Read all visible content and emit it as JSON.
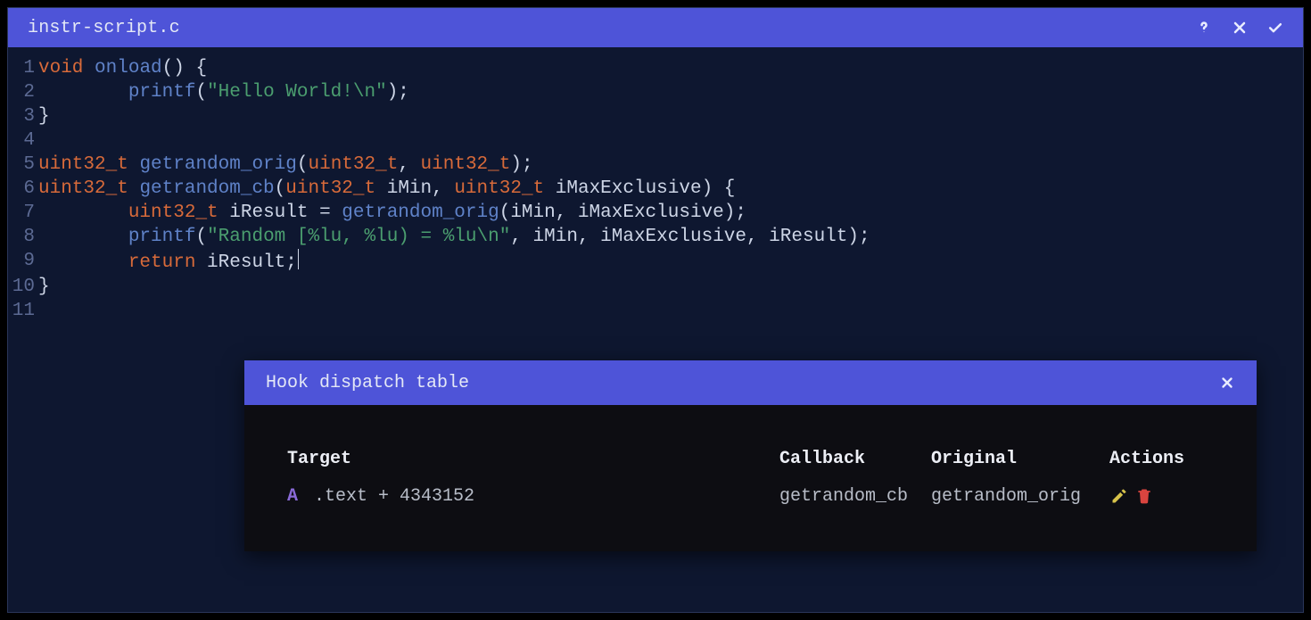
{
  "titlebar": {
    "filename": "instr-script.c",
    "help_icon": "help-icon",
    "close_icon": "close-icon",
    "accept_icon": "check-icon"
  },
  "code": {
    "lines": [
      {
        "n": 1,
        "tokens": [
          {
            "t": "kw",
            "v": "void"
          },
          {
            "t": "pun",
            "v": " "
          },
          {
            "t": "fn",
            "v": "onload"
          },
          {
            "t": "pun",
            "v": "() {"
          }
        ]
      },
      {
        "n": 2,
        "tokens": [
          {
            "t": "pun",
            "v": "        "
          },
          {
            "t": "fn",
            "v": "printf"
          },
          {
            "t": "pun",
            "v": "("
          },
          {
            "t": "str",
            "v": "\"Hello World!\\n\""
          },
          {
            "t": "pun",
            "v": ");"
          }
        ]
      },
      {
        "n": 3,
        "tokens": [
          {
            "t": "pun",
            "v": "}"
          }
        ]
      },
      {
        "n": 4,
        "tokens": [
          {
            "t": "pun",
            "v": ""
          }
        ]
      },
      {
        "n": 5,
        "tokens": [
          {
            "t": "kw",
            "v": "uint32_t"
          },
          {
            "t": "pun",
            "v": " "
          },
          {
            "t": "fn",
            "v": "getrandom_orig"
          },
          {
            "t": "pun",
            "v": "("
          },
          {
            "t": "kw",
            "v": "uint32_t"
          },
          {
            "t": "pun",
            "v": ", "
          },
          {
            "t": "kw",
            "v": "uint32_t"
          },
          {
            "t": "pun",
            "v": ");"
          }
        ]
      },
      {
        "n": 6,
        "tokens": [
          {
            "t": "kw",
            "v": "uint32_t"
          },
          {
            "t": "pun",
            "v": " "
          },
          {
            "t": "fn",
            "v": "getrandom_cb"
          },
          {
            "t": "pun",
            "v": "("
          },
          {
            "t": "kw",
            "v": "uint32_t"
          },
          {
            "t": "pun",
            "v": " iMin, "
          },
          {
            "t": "kw",
            "v": "uint32_t"
          },
          {
            "t": "pun",
            "v": " iMaxExclusive) {"
          }
        ]
      },
      {
        "n": 7,
        "tokens": [
          {
            "t": "pun",
            "v": "        "
          },
          {
            "t": "kw",
            "v": "uint32_t"
          },
          {
            "t": "pun",
            "v": " iResult = "
          },
          {
            "t": "fn",
            "v": "getrandom_orig"
          },
          {
            "t": "pun",
            "v": "(iMin, iMaxExclusive);"
          }
        ]
      },
      {
        "n": 8,
        "tokens": [
          {
            "t": "pun",
            "v": "        "
          },
          {
            "t": "fn",
            "v": "printf"
          },
          {
            "t": "pun",
            "v": "("
          },
          {
            "t": "str",
            "v": "\"Random [%lu, %lu) = %lu\\n\""
          },
          {
            "t": "pun",
            "v": ", iMin, iMaxExclusive, iResult);"
          }
        ]
      },
      {
        "n": 9,
        "tokens": [
          {
            "t": "pun",
            "v": "        "
          },
          {
            "t": "kw",
            "v": "return"
          },
          {
            "t": "pun",
            "v": " iResult;"
          }
        ],
        "cursor": true
      },
      {
        "n": 10,
        "tokens": [
          {
            "t": "pun",
            "v": "}"
          }
        ]
      },
      {
        "n": 11,
        "tokens": [
          {
            "t": "pun",
            "v": ""
          }
        ]
      }
    ]
  },
  "panel": {
    "title": "Hook dispatch table",
    "headers": {
      "target": "Target",
      "callback": "Callback",
      "original": "Original",
      "actions": "Actions"
    },
    "rows": [
      {
        "mode": "A",
        "target": ".text + 4343152",
        "callback": "getrandom_cb",
        "original": "getrandom_orig"
      }
    ],
    "icons": {
      "edit": "pencil-icon",
      "delete": "trash-icon",
      "close": "close-icon"
    }
  }
}
